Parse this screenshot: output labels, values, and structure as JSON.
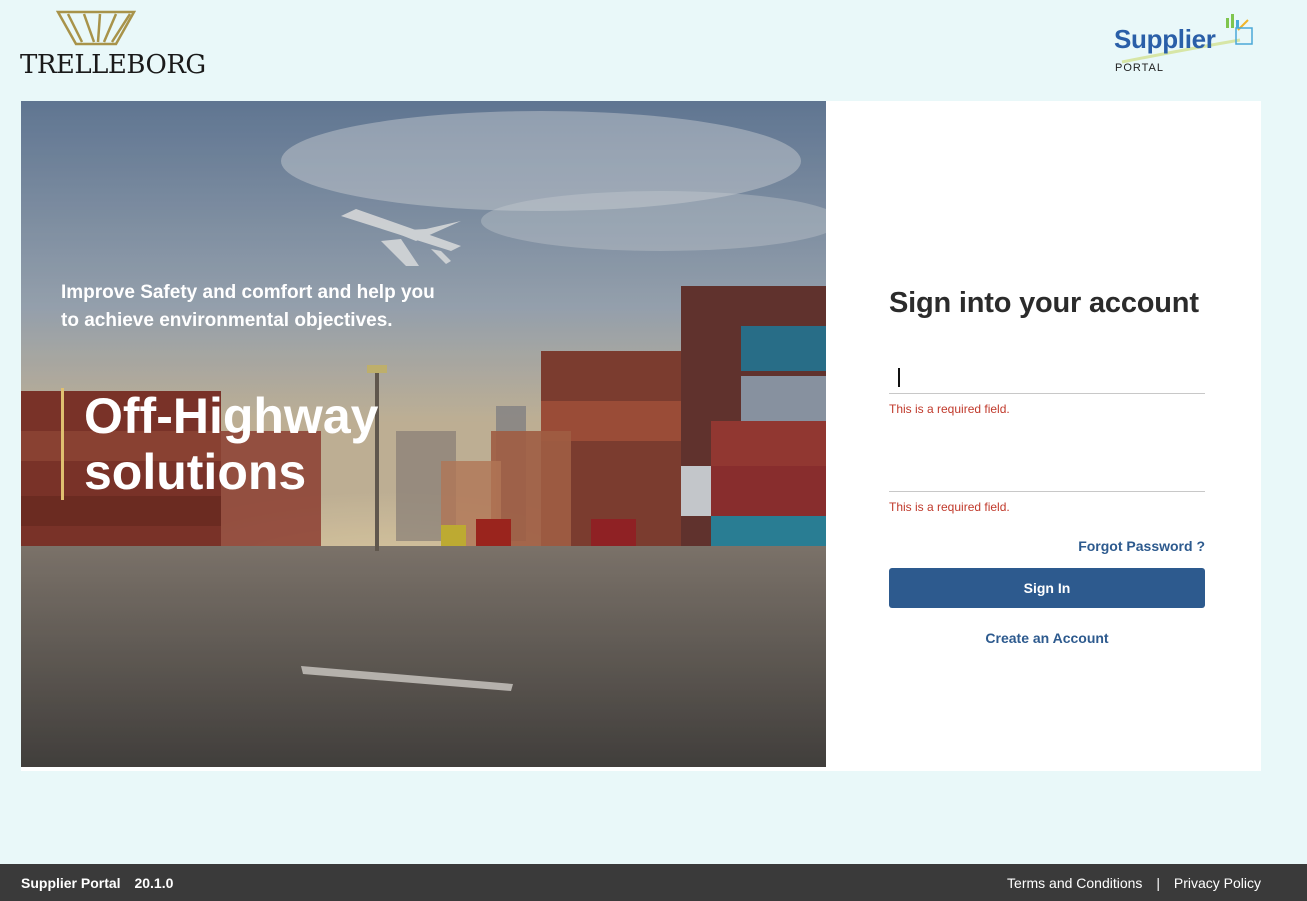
{
  "header": {
    "trelleborg_logo": "TRELLEBORG",
    "supplier_logo": {
      "brand": "Supplier",
      "sub": "PORTAL"
    }
  },
  "hero": {
    "tagline": "Improve Safety and comfort and help you to achieve environmental objectives.",
    "headline_line1": "Off-Highway",
    "headline_line2": "solutions"
  },
  "signin": {
    "title": "Sign into your account",
    "username_value": "",
    "username_error": "This is a required field.",
    "password_value": "",
    "password_error": "This is a required field.",
    "forgot_label": "Forgot Password ?",
    "signin_label": "Sign In",
    "create_label": "Create an Account"
  },
  "footer": {
    "app_name": "Supplier Portal",
    "version": "20.1.0",
    "terms_label": "Terms and Conditions",
    "separator": "|",
    "privacy_label": "Privacy Policy"
  },
  "colors": {
    "page_bg": "#e9f8f9",
    "primary": "#2d5a8e",
    "error": "#c0392b",
    "footer_bg": "#3a3a3a",
    "accent": "#e0c070"
  }
}
